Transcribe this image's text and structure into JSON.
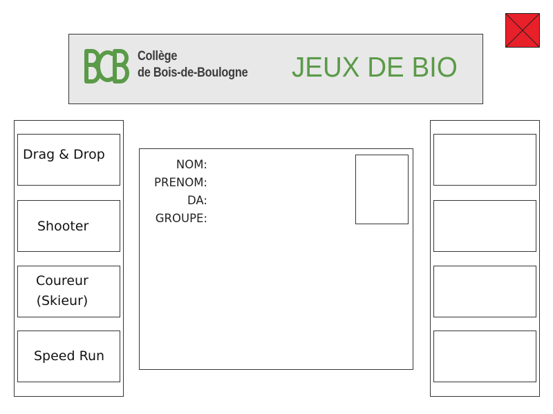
{
  "header": {
    "college_line1": "Collège",
    "college_line2": "de Bois-de-Boulogne",
    "title": "JEUX DE BIO",
    "logo_icon": "bdb-logo-icon",
    "title_color": "#5a9a48"
  },
  "close_button": {
    "icon": "close-icon",
    "color": "#e8202a"
  },
  "games": [
    {
      "label": "Drag & Drop"
    },
    {
      "label": "Shooter"
    },
    {
      "label": "Coureur\n(Skieur)"
    },
    {
      "label": "Speed Run"
    }
  ],
  "right_slots": [
    {
      "label": ""
    },
    {
      "label": ""
    },
    {
      "label": ""
    },
    {
      "label": ""
    }
  ],
  "student_info": {
    "nom_label": "NOM:",
    "prenom_label": "PRENOM:",
    "da_label": "DA:",
    "groupe_label": "GROUPE:"
  }
}
